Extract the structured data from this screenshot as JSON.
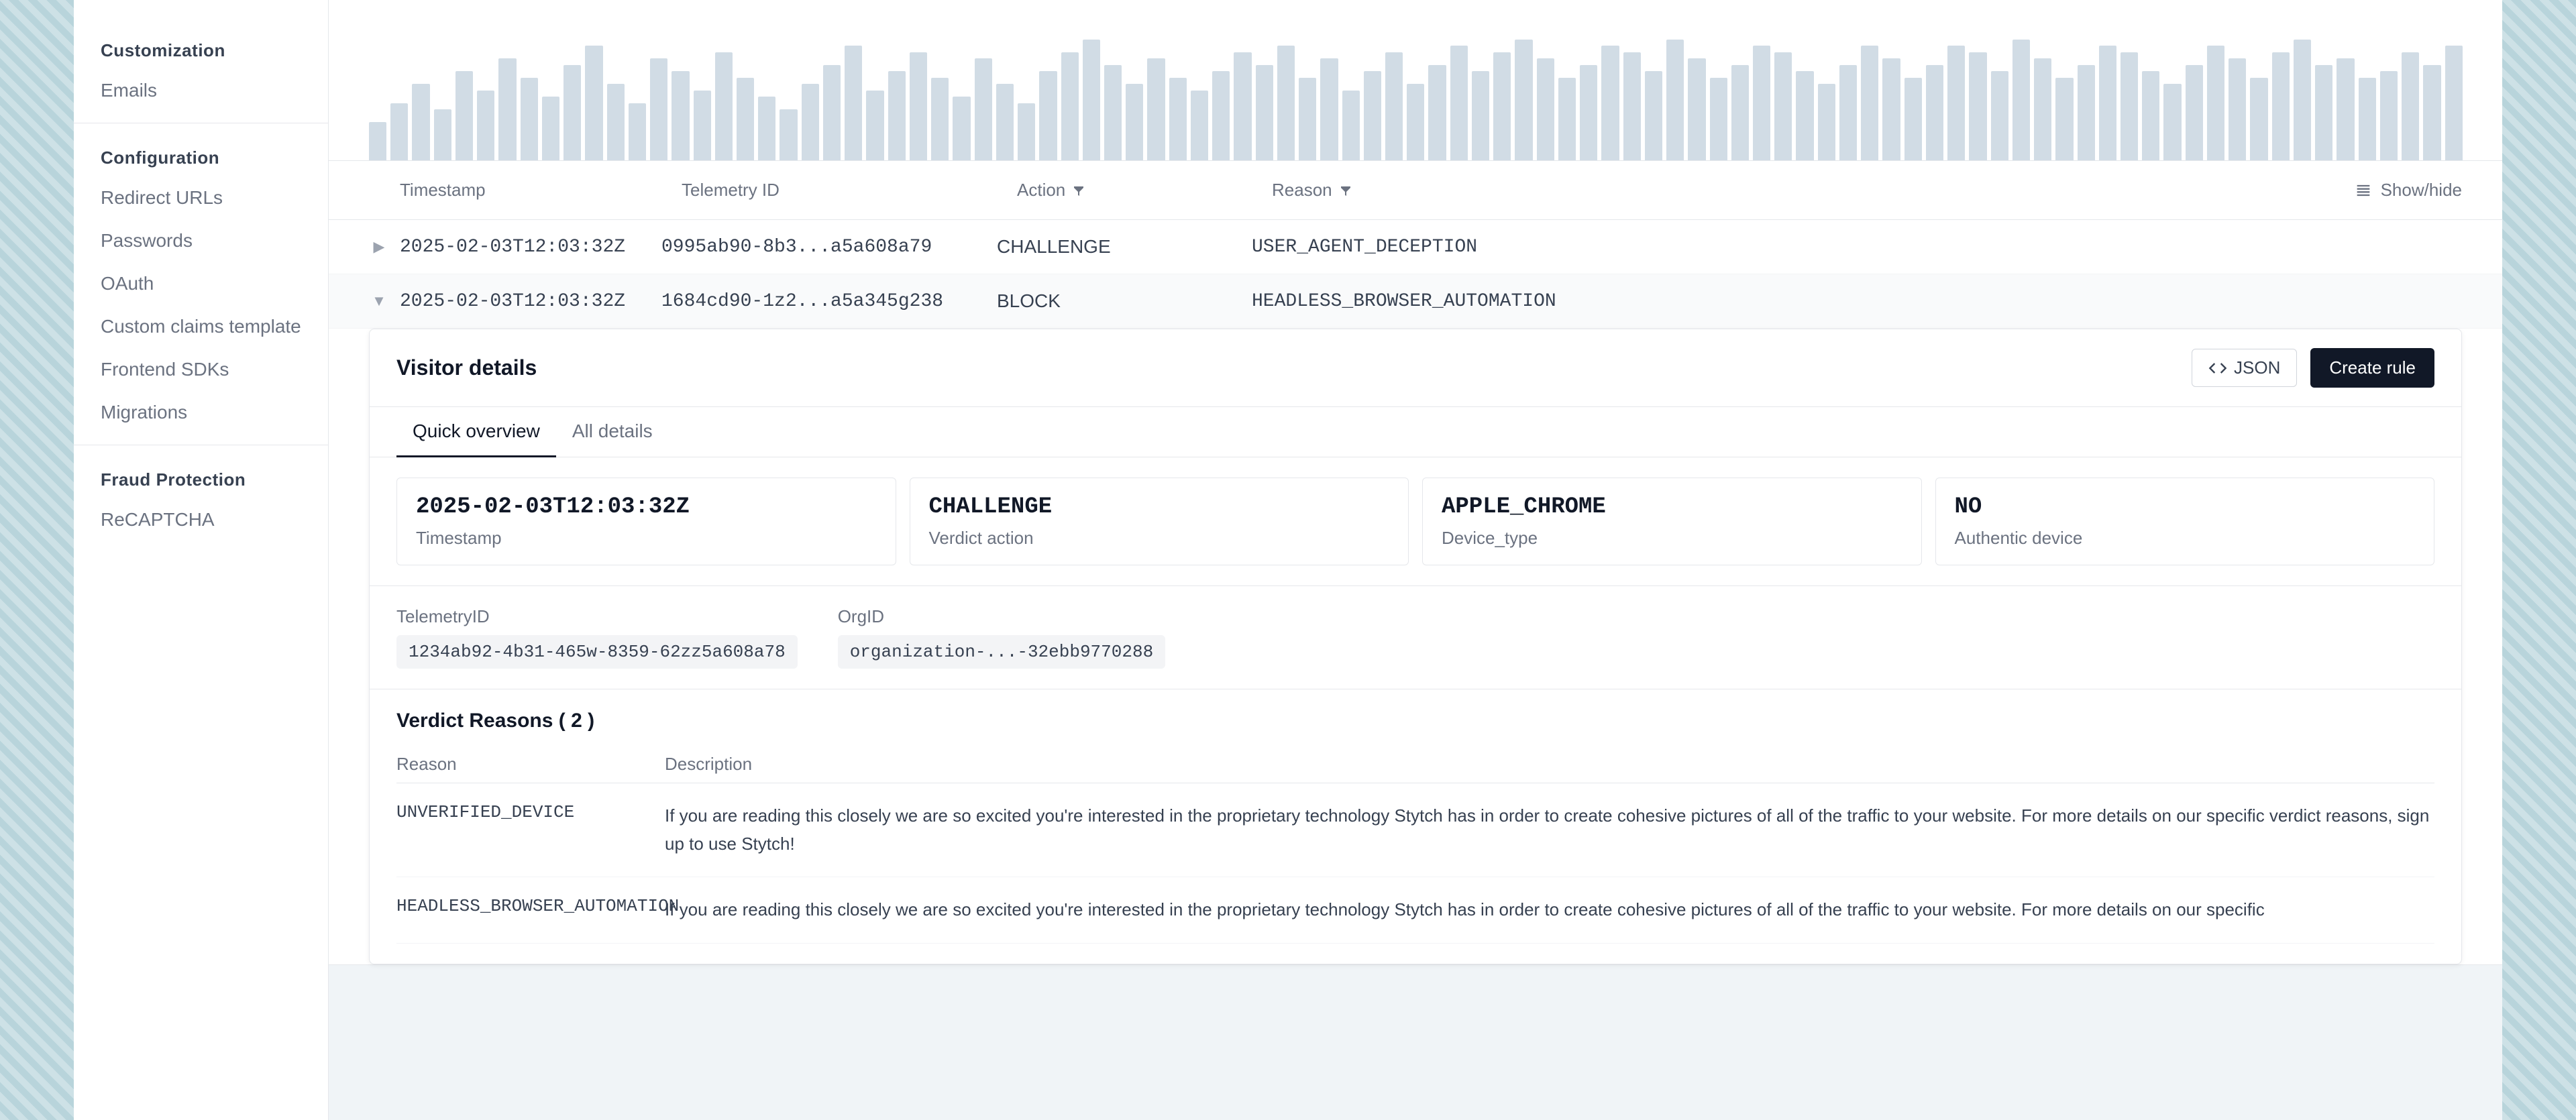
{
  "sidebar": {
    "customization_title": "Customization",
    "items_customization": [
      {
        "label": "Emails",
        "id": "emails"
      }
    ],
    "configuration_title": "Configuration",
    "items_configuration": [
      {
        "label": "Redirect URLs",
        "id": "redirect-urls"
      },
      {
        "label": "Passwords",
        "id": "passwords"
      },
      {
        "label": "OAuth",
        "id": "oauth"
      },
      {
        "label": "Custom claims template",
        "id": "custom-claims"
      },
      {
        "label": "Frontend SDKs",
        "id": "frontend-sdks"
      },
      {
        "label": "Migrations",
        "id": "migrations"
      }
    ],
    "fraud_title": "Fraud Protection",
    "items_fraud": [
      {
        "label": "ReCAPTCHA",
        "id": "recaptcha"
      }
    ]
  },
  "table": {
    "col_timestamp": "Timestamp",
    "col_telemetry": "Telemetry ID",
    "col_action": "Action",
    "col_reason": "Reason",
    "show_hide_label": "Show/hide",
    "rows": [
      {
        "timestamp": "2025-02-03T12:03:32Z",
        "telemetry": "0995ab90-8b3...a5a608a79",
        "action": "CHALLENGE",
        "reason": "USER_AGENT_DECEPTION",
        "expanded": false
      },
      {
        "timestamp": "2025-02-03T12:03:32Z",
        "telemetry": "1684cd90-1z2...a5a345g238",
        "action": "BLOCK",
        "reason": "HEADLESS_BROWSER_AUTOMATION",
        "expanded": true
      }
    ]
  },
  "visitor_details": {
    "title": "Visitor details",
    "json_btn_label": "JSON",
    "create_rule_btn": "Create rule",
    "tabs": [
      {
        "label": "Quick overview",
        "active": true
      },
      {
        "label": "All details",
        "active": false
      }
    ],
    "cards": [
      {
        "value": "2025-02-03T12:03:32Z",
        "label": "Timestamp"
      },
      {
        "value": "CHALLENGE",
        "label": "Verdict action"
      },
      {
        "value": "APPLE_CHROME",
        "label": "Device_type"
      },
      {
        "value": "NO",
        "label": "Authentic device"
      }
    ],
    "telemetry_label": "TelemetryID",
    "telemetry_value": "1234ab92-4b31-465w-8359-62zz5a608a78",
    "orgid_label": "OrgID",
    "orgid_value": "organization-...-32ebb9770288",
    "verdict_reasons_title": "Verdict Reasons ( 2 )",
    "verdict_col_reason": "Reason",
    "verdict_col_description": "Description",
    "verdict_rows": [
      {
        "reason": "UNVERIFIED_DEVICE",
        "description": "If you are reading this closely we are so excited you're interested in the proprietary technology Stytch has in order to create cohesive pictures of all of the traffic to your website. For more details on our specific verdict reasons, sign up to use Stytch!"
      },
      {
        "reason": "HEADLESS_BROWSER_AUTOMATION",
        "description": "If you are reading this closely we are so excited you're interested in the proprietary technology Stytch has in order to create cohesive pictures of all of the traffic to your website. For more details on our specific"
      }
    ]
  },
  "chart": {
    "bars": [
      30,
      45,
      60,
      40,
      70,
      55,
      80,
      65,
      50,
      75,
      90,
      60,
      45,
      80,
      70,
      55,
      85,
      65,
      50,
      40,
      60,
      75,
      90,
      55,
      70,
      85,
      65,
      50,
      80,
      60,
      45,
      70,
      85,
      95,
      75,
      60,
      80,
      65,
      55,
      70,
      85,
      75,
      90,
      65,
      80,
      55,
      70,
      85,
      60,
      75,
      90,
      70,
      85,
      95,
      80,
      65,
      75,
      90,
      85,
      70,
      95,
      80,
      65,
      75,
      90,
      85,
      70,
      60,
      75,
      90,
      80,
      65,
      75,
      90,
      85,
      70,
      95,
      80,
      65,
      75,
      90,
      85,
      70,
      60,
      75,
      90,
      80,
      65,
      85,
      95,
      75,
      80,
      65,
      70,
      85,
      75,
      90
    ]
  }
}
